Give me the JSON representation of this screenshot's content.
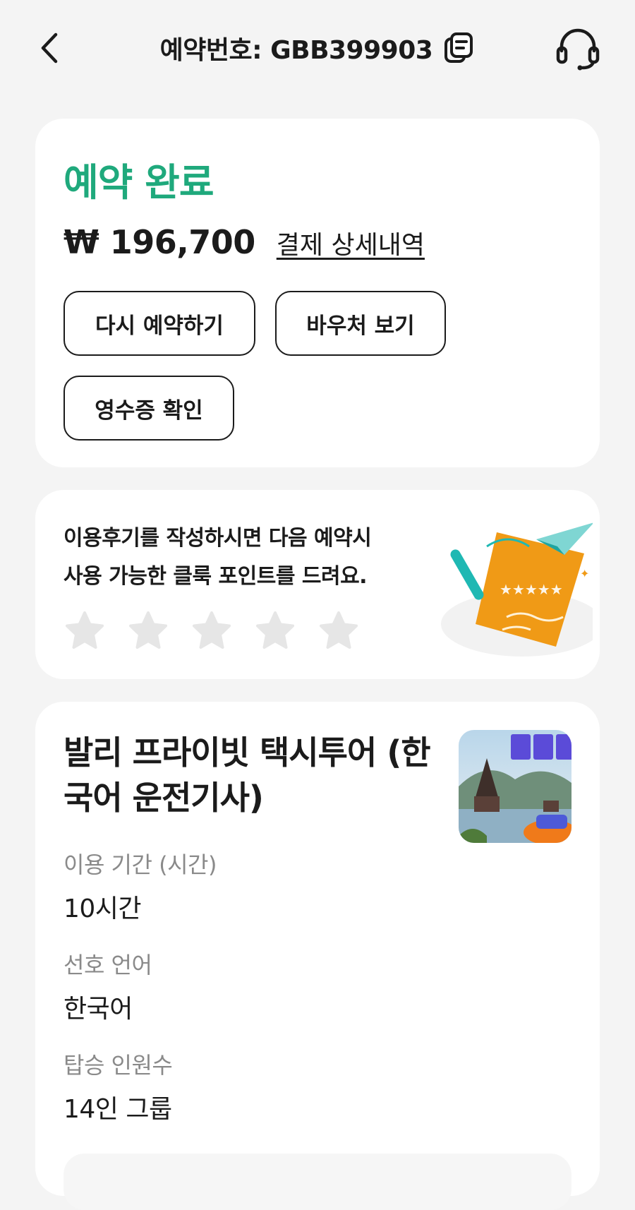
{
  "header": {
    "title": "예약번호: GBB399903",
    "back_icon": "chevron-left-icon",
    "copy_icon": "copy-icon",
    "support_icon": "headset-icon"
  },
  "status_card": {
    "status": "예약 완료",
    "status_color": "#1fa97c",
    "price": "₩ 196,700",
    "payment_details_link": "결제 상세내역",
    "buttons": {
      "rebook": "다시 예약하기",
      "voucher": "바우처 보기",
      "receipt": "영수증 확인"
    }
  },
  "review_card": {
    "message_line1": "이용후기를 작성하시면 다음 예약시",
    "message_line2": "사용 가능한 클룩 포인트를 드려요.",
    "rating": 0,
    "max_rating": 5,
    "illustration": "review-paper-plane-illustration"
  },
  "product_card": {
    "title_line1": "발리 프라이빗 택시투어 (한",
    "title_line2": "국어 운전기사)",
    "details": [
      {
        "label": "이용 기간 (시간)",
        "value": "10시간"
      },
      {
        "label": "선호 언어",
        "value": "한국어"
      },
      {
        "label": "탑승 인원수",
        "value": "14인 그룹"
      }
    ]
  }
}
